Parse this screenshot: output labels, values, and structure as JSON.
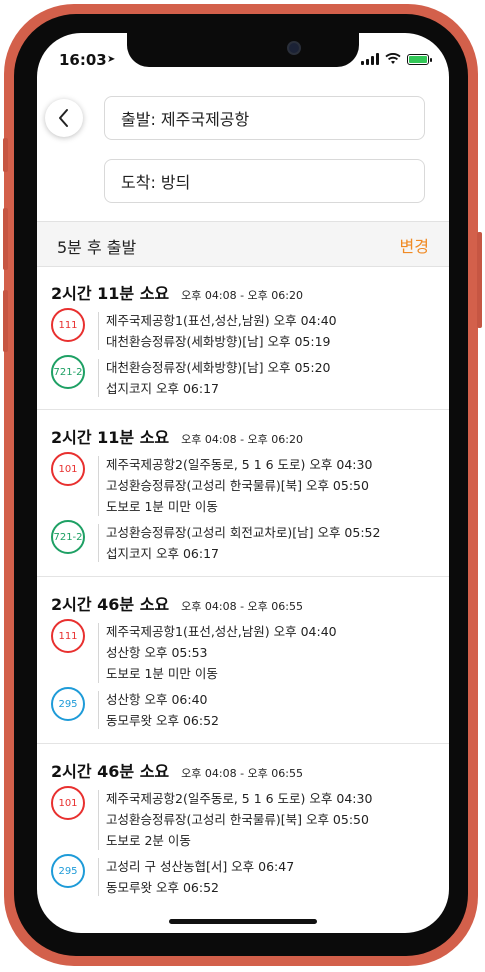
{
  "status_bar": {
    "time": "16:03"
  },
  "search": {
    "from": "출발: 제주국제공항",
    "to": "도착: 방듸"
  },
  "departure": {
    "label": "5분 후 출발",
    "change": "변경"
  },
  "colors": {
    "red": "#e8302f",
    "green": "#1ea064",
    "blue": "#1e9bd8",
    "accent": "#f08a24"
  },
  "routes": [
    {
      "duration": "2시간 11분 소요",
      "timespan": "오후 04:08 - 오후 06:20",
      "legs": [
        {
          "bus": "111",
          "color": "red",
          "stops": [
            "제주국제공항1(표선,성산,남원) 오후 04:40",
            "대천환승정류장(세화방향)[남] 오후 05:19"
          ]
        },
        {
          "bus": "721-2",
          "color": "green",
          "stops": [
            "대천환승정류장(세화방향)[남] 오후 05:20",
            "섭지코지 오후 06:17"
          ]
        }
      ]
    },
    {
      "duration": "2시간 11분 소요",
      "timespan": "오후 04:08 - 오후 06:20",
      "legs": [
        {
          "bus": "101",
          "color": "red",
          "stops": [
            "제주국제공항2(일주동로, 5 1 6 도로) 오후 04:30",
            "고성환승정류장(고성리 한국물류)[북] 오후 05:50",
            "도보로 1분 미만 이동"
          ]
        },
        {
          "bus": "721-2",
          "color": "green",
          "stops": [
            "고성환승정류장(고성리 회전교차로)[남] 오후 05:52",
            "섭지코지 오후 06:17"
          ]
        }
      ]
    },
    {
      "duration": "2시간 46분 소요",
      "timespan": "오후 04:08 - 오후 06:55",
      "legs": [
        {
          "bus": "111",
          "color": "red",
          "stops": [
            "제주국제공항1(표선,성산,남원) 오후 04:40",
            "성산항 오후 05:53",
            "도보로 1분 미만 이동"
          ]
        },
        {
          "bus": "295",
          "color": "blue",
          "stops": [
            "성산항 오후 06:40",
            "동모루왓 오후 06:52"
          ]
        }
      ]
    },
    {
      "duration": "2시간 46분 소요",
      "timespan": "오후 04:08 - 오후 06:55",
      "legs": [
        {
          "bus": "101",
          "color": "red",
          "stops": [
            "제주국제공항2(일주동로, 5 1 6 도로) 오후 04:30",
            "고성환승정류장(고성리 한국물류)[북] 오후 05:50",
            "도보로 2분 이동"
          ]
        },
        {
          "bus": "295",
          "color": "blue",
          "stops": [
            "고성리 구 성산농협[서] 오후 06:47",
            "동모루왓 오후 06:52"
          ]
        }
      ]
    }
  ]
}
